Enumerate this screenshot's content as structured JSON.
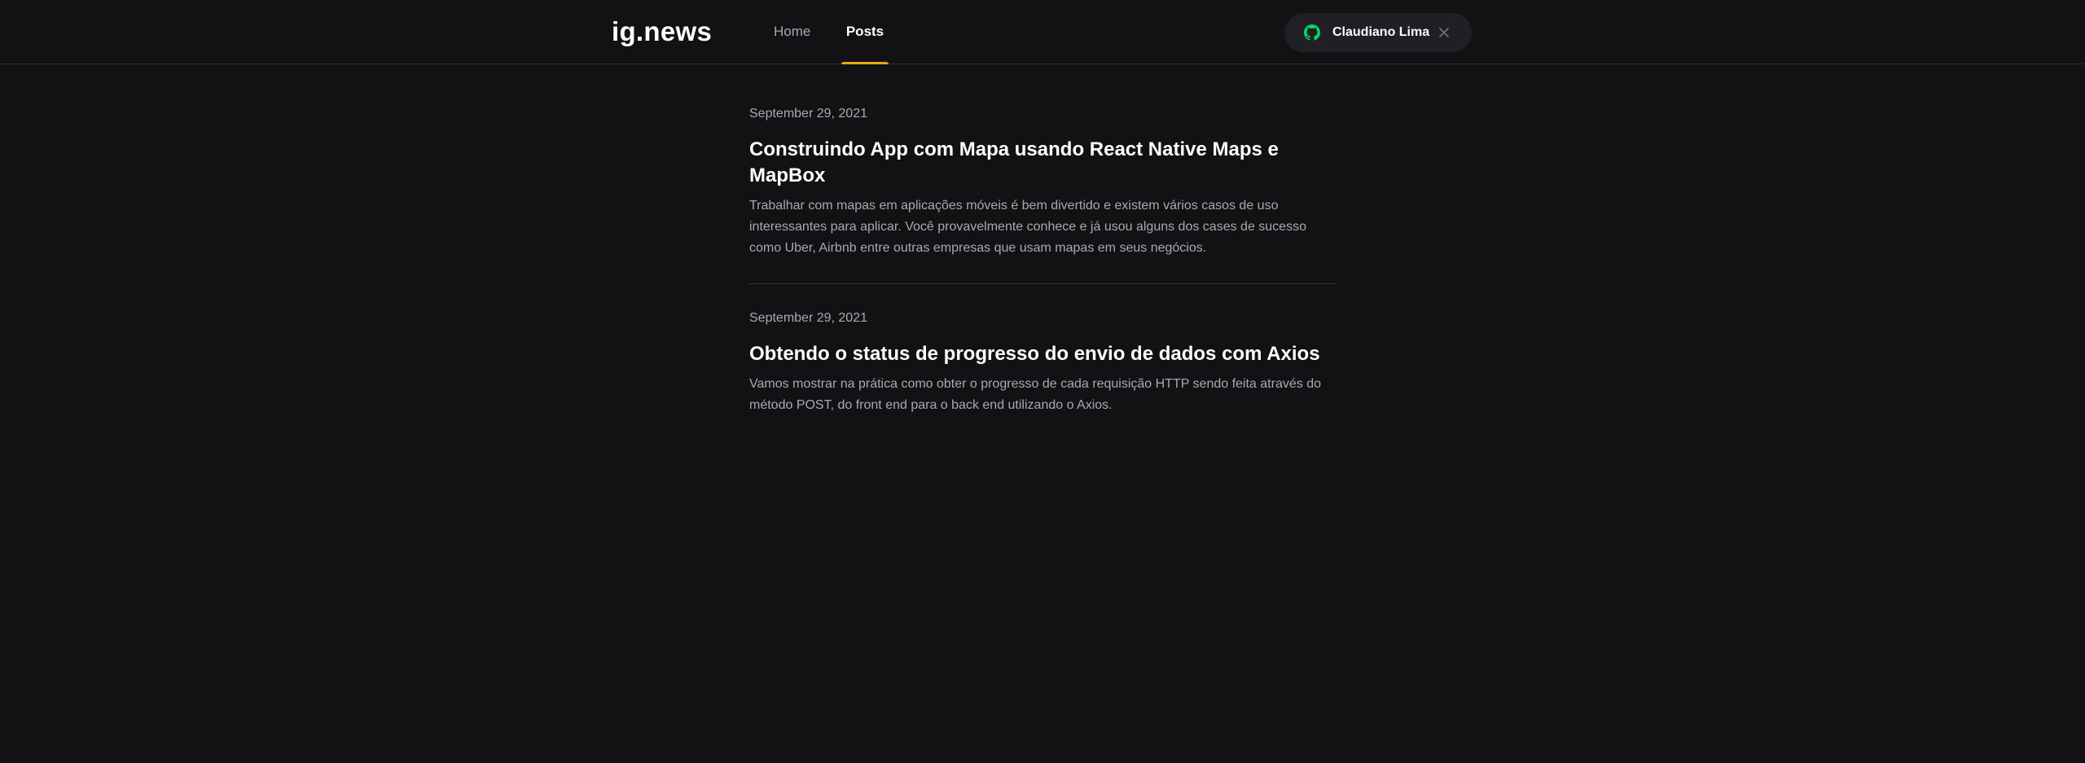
{
  "header": {
    "logo": "ig.news",
    "nav": [
      {
        "label": "Home",
        "active": false
      },
      {
        "label": "Posts",
        "active": true
      }
    ],
    "user": {
      "name": "Claudiano Lima",
      "icon": "github-icon",
      "close_icon": "close-icon"
    }
  },
  "posts": [
    {
      "date": "September 29, 2021",
      "title": "Construindo App com Mapa usando React Native Maps e MapBox",
      "excerpt": "Trabalhar com mapas em aplicações móveis é bem divertido e existem vários casos de uso interessantes para aplicar. Você provavelmente conhece e já usou alguns dos cases de sucesso como Uber, Airbnb entre outras empresas que usam mapas em seus negócios."
    },
    {
      "date": "September 29, 2021",
      "title": "Obtendo o status de progresso do envio de dados com Axios",
      "excerpt": "Vamos mostrar na prática como obter o progresso de cada requisição HTTP sendo feita através do método POST, do front end para o back end utilizando o Axios."
    }
  ],
  "colors": {
    "background": "#121214",
    "accent": "#eba417",
    "github": "#04d361"
  }
}
